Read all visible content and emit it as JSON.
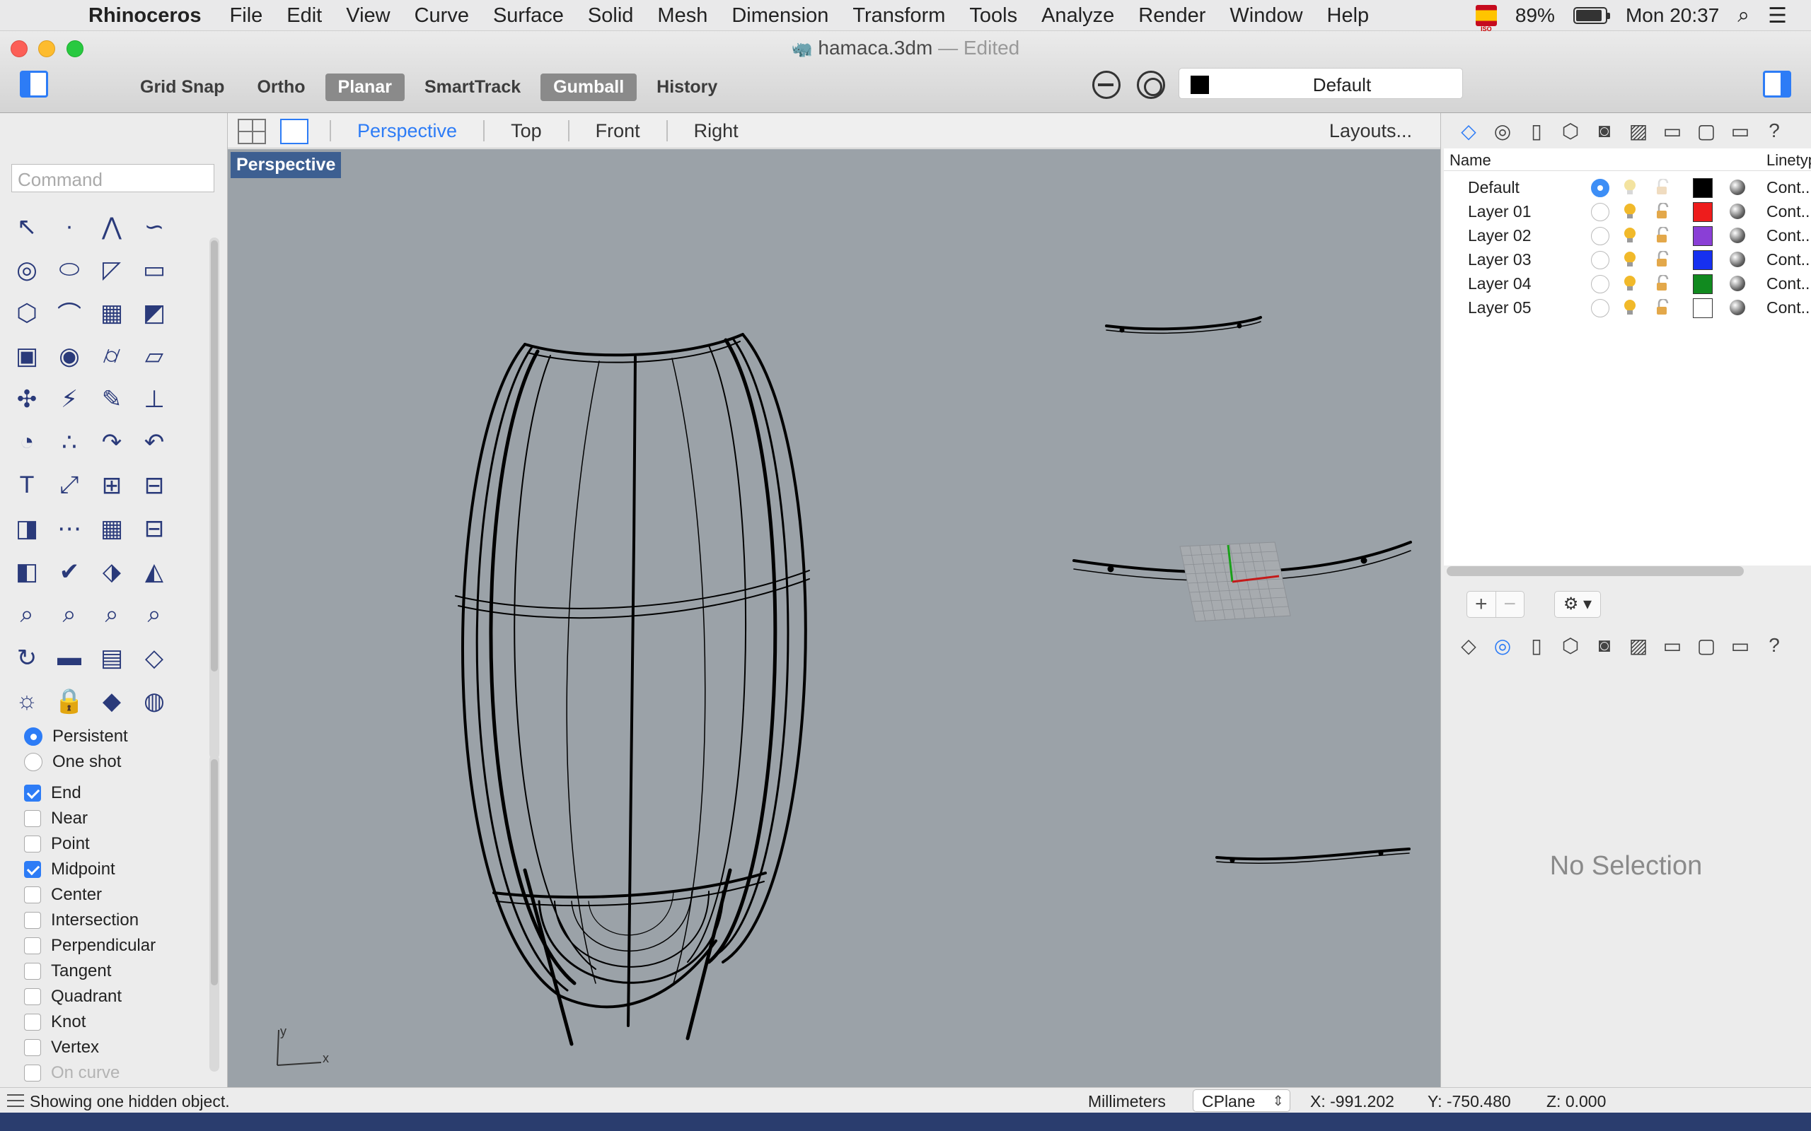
{
  "menubar": {
    "app_name": "Rhinoceros",
    "items": [
      "File",
      "Edit",
      "View",
      "Curve",
      "Surface",
      "Solid",
      "Mesh",
      "Dimension",
      "Transform",
      "Tools",
      "Analyze",
      "Render",
      "Window",
      "Help"
    ],
    "status": {
      "battery_pct": "89%",
      "clock": "Mon 20:37",
      "flag_label": "ISO"
    }
  },
  "window": {
    "title": "hamaca.3dm",
    "title_sep": "—",
    "title_state": "Edited"
  },
  "toolbar": {
    "modes": [
      {
        "label": "Grid Snap",
        "active": false
      },
      {
        "label": "Ortho",
        "active": false
      },
      {
        "label": "Planar",
        "active": true
      },
      {
        "label": "SmartTrack",
        "active": false
      },
      {
        "label": "Gumball",
        "active": true
      },
      {
        "label": "History",
        "active": false
      }
    ],
    "current_layer": "Default",
    "current_layer_color": "#000000"
  },
  "viewport_tabs": {
    "tabs": [
      "Perspective",
      "Top",
      "Front",
      "Right"
    ],
    "selected": "Perspective",
    "layouts_label": "Layouts..."
  },
  "viewport": {
    "label": "Perspective",
    "background": "#9ba2a8",
    "axis_x": "x",
    "axis_y": "y"
  },
  "command": {
    "placeholder": "Command"
  },
  "osnap": {
    "modes": [
      {
        "label": "Persistent",
        "selected": true
      },
      {
        "label": "One shot",
        "selected": false
      }
    ],
    "snaps": [
      {
        "label": "End",
        "checked": true
      },
      {
        "label": "Near",
        "checked": false
      },
      {
        "label": "Point",
        "checked": false
      },
      {
        "label": "Midpoint",
        "checked": true
      },
      {
        "label": "Center",
        "checked": false
      },
      {
        "label": "Intersection",
        "checked": false
      },
      {
        "label": "Perpendicular",
        "checked": false
      },
      {
        "label": "Tangent",
        "checked": false
      },
      {
        "label": "Quadrant",
        "checked": false
      },
      {
        "label": "Knot",
        "checked": false
      },
      {
        "label": "Vertex",
        "checked": false
      },
      {
        "label": "On curve",
        "checked": false,
        "disabled": true
      }
    ]
  },
  "layers": {
    "col_name": "Name",
    "col_linetype": "Linetyp",
    "rows": [
      {
        "name": "Default",
        "current": true,
        "color": "#000000",
        "linetype": "Cont..",
        "dim": true
      },
      {
        "name": "Layer 01",
        "current": false,
        "color": "#ee1c1c",
        "linetype": "Cont..",
        "dim": false
      },
      {
        "name": "Layer 02",
        "current": false,
        "color": "#8a3fd6",
        "linetype": "Cont..",
        "dim": false
      },
      {
        "name": "Layer 03",
        "current": false,
        "color": "#1630f0",
        "linetype": "Cont..",
        "dim": false
      },
      {
        "name": "Layer 04",
        "current": false,
        "color": "#118a1f",
        "linetype": "Cont..",
        "dim": false
      },
      {
        "name": "Layer 05",
        "current": false,
        "color": "#ffffff",
        "linetype": "Cont..",
        "dim": false
      }
    ],
    "add_label": "+",
    "remove_label": "−",
    "gear_label": "⚙ ▾"
  },
  "properties": {
    "empty_text": "No Selection"
  },
  "statusbar": {
    "message": "Showing one hidden object.",
    "units": "Millimeters",
    "cplane": "CPlane",
    "x": "X: -991.202",
    "y": "Y: -750.480",
    "z": "Z: 0.000"
  },
  "colors": {
    "accent": "#2d7cf6",
    "viewport_label_bg": "#3d5f91"
  }
}
